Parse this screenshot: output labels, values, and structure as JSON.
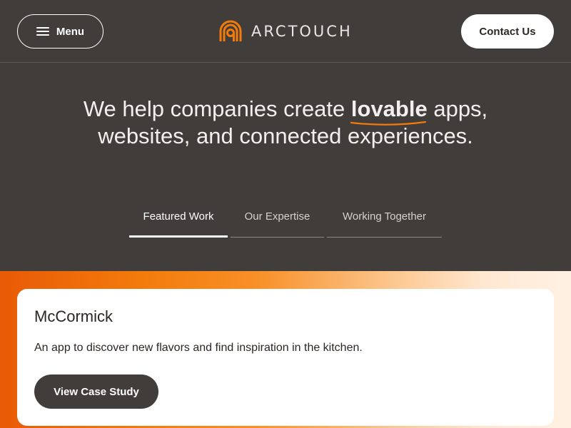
{
  "header": {
    "menu_label": "Menu",
    "logo_text_bold": "ARC",
    "logo_text_light": "TOUCH",
    "contact_label": "Contact Us"
  },
  "hero": {
    "line1_before": "We help companies create ",
    "line1_highlight": "lovable",
    "line1_after": " apps,",
    "line2": "websites, and connected experiences."
  },
  "tabs": [
    {
      "label": "Featured Work",
      "active": true
    },
    {
      "label": "Our Expertise",
      "active": false
    },
    {
      "label": "Working Together",
      "active": false
    }
  ],
  "feature_card": {
    "title": "McCormick",
    "description": "An app to discover new flavors and find inspiration in the kitchen.",
    "button_label": "View Case Study"
  },
  "colors": {
    "background": "#413d3b",
    "accent_orange": "#f37b0c",
    "white": "#ffffff"
  },
  "icons": [
    "hamburger-icon",
    "arctouch-logo-icon"
  ]
}
